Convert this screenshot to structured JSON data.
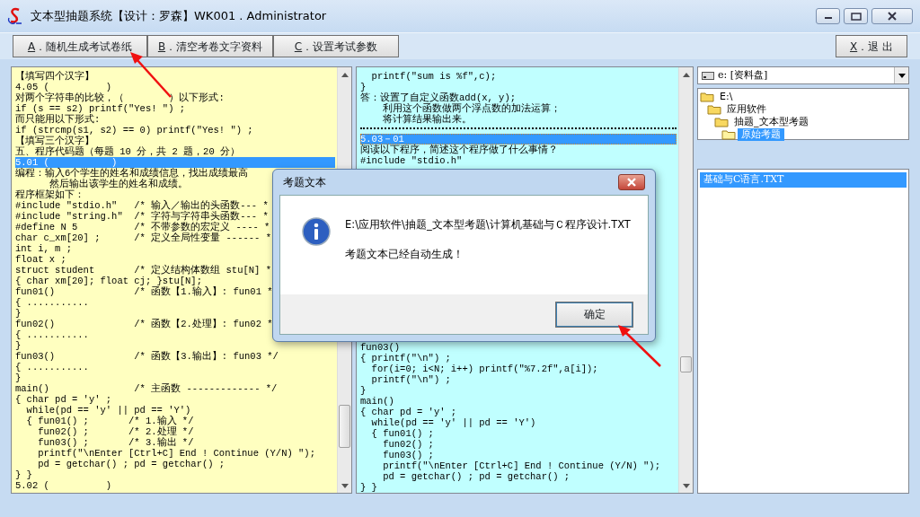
{
  "window": {
    "title": "文本型抽题系统【设计：罗森】WK001 . Administrator"
  },
  "toolbar": [
    {
      "key": "A",
      "label": "．随机生成考试卷纸"
    },
    {
      "key": "B",
      "label": "．清空考卷文字资料"
    },
    {
      "key": "C",
      "label": "．设置考试参数"
    }
  ],
  "exit_button": {
    "key": "X",
    "label": "．退 出"
  },
  "question_pane": {
    "lines": [
      {
        "text": "【填写四个汉字】",
        "selected": false
      },
      {
        "text": "4.05 (          )",
        "selected": false
      },
      {
        "text": "对两个字符串的比较，（        ）以下形式:",
        "selected": false
      },
      {
        "text": "if (s == s2) printf(\"Yes! \") ;",
        "selected": false
      },
      {
        "text": "而只能用以下形式:",
        "selected": false
      },
      {
        "text": "if (strcmp(s1, s2) == 0) printf(\"Yes! \") ;",
        "selected": false
      },
      {
        "text": "【填写三个汉字】",
        "selected": false
      },
      {
        "text": "五、程序代码题（每题 10 分，共 2 题，20 分）",
        "selected": false
      },
      {
        "text": "5.01 (           )",
        "selected": true
      },
      {
        "text": "编程：输入6个学生的姓名和成绩信息，找出成绩最高",
        "selected": false
      },
      {
        "text": "      然后输出该学生的姓名和成绩。",
        "selected": false
      },
      {
        "text": "程序框架如下：",
        "selected": false
      },
      {
        "text": "#include \"stdio.h\"   /* 输入／输出的头函数--- *",
        "selected": false
      },
      {
        "text": "#include \"string.h\"  /* 字符与字符串头函数--- *",
        "selected": false
      },
      {
        "text": "#define N 5          /* 不带参数的宏定义 ---- *",
        "selected": false
      },
      {
        "text": "char c_xm[20] ;      /* 定义全局性变量 ------ *",
        "selected": false
      },
      {
        "text": "int i, m ;",
        "selected": false
      },
      {
        "text": "float x ;",
        "selected": false
      },
      {
        "text": "struct student       /* 定义结构体数组 stu[N] *",
        "selected": false
      },
      {
        "text": "{ char xm[20]; float cj; }stu[N];",
        "selected": false
      },
      {
        "text": "fun01()              /* 函数【1.输入】: fun01 *",
        "selected": false
      },
      {
        "text": "{ ...........",
        "selected": false
      },
      {
        "text": "}",
        "selected": false
      },
      {
        "text": "fun02()              /* 函数【2.处理】: fun02 *",
        "selected": false
      },
      {
        "text": "{ ...........",
        "selected": false
      },
      {
        "text": "}",
        "selected": false
      },
      {
        "text": "fun03()              /* 函数【3.输出】: fun03 */",
        "selected": false
      },
      {
        "text": "{ ...........",
        "selected": false
      },
      {
        "text": "}",
        "selected": false
      },
      {
        "text": "main()               /* 主函数 ------------- */",
        "selected": false
      },
      {
        "text": "{ char pd = 'y' ;",
        "selected": false
      },
      {
        "text": "  while(pd == 'y' || pd == 'Y')",
        "selected": false
      },
      {
        "text": "  { fun01() ;       /* 1.输入 */",
        "selected": false
      },
      {
        "text": "    fun02() ;       /* 2.处理 */",
        "selected": false
      },
      {
        "text": "    fun03() ;       /* 3.输出 */",
        "selected": false
      },
      {
        "text": "    printf(\"\\nEnter [Ctrl+C] End ! Continue (Y/N) \");",
        "selected": false
      },
      {
        "text": "    pd = getchar() ; pd = getchar() ;",
        "selected": false
      },
      {
        "text": "} }",
        "selected": false
      },
      {
        "text": "5.02 (          )",
        "selected": false
      }
    ]
  },
  "answer_pane": {
    "lines_top": [
      {
        "text": "  printf(\"sum is %f\",c);",
        "selected": false
      },
      {
        "text": "}",
        "selected": false
      },
      {
        "text": "答：设置了自定义函数add(x, y);",
        "selected": false
      },
      {
        "text": "    利用这个函数做两个浮点数的加法运算；",
        "selected": false
      },
      {
        "text": "    将计算结果输出来。",
        "selected": false
      },
      {
        "kind": "separator"
      },
      {
        "text": "5.03－01",
        "selected": true
      },
      {
        "text": "阅读以下程序，简述这个程序做了什么事情？",
        "selected": false
      },
      {
        "text": "#include \"stdio.h\"",
        "selected": false
      }
    ],
    "lines_bottom": [
      {
        "text": "fun03()",
        "selected": false
      },
      {
        "text": "{ printf(\"\\n\") ;",
        "selected": false
      },
      {
        "text": "  for(i=0; i<N; i++) printf(\"%7.2f\",a[i]);",
        "selected": false
      },
      {
        "text": "  printf(\"\\n\") ;",
        "selected": false
      },
      {
        "text": "}",
        "selected": false
      },
      {
        "text": "main()",
        "selected": false
      },
      {
        "text": "{ char pd = 'y' ;",
        "selected": false
      },
      {
        "text": "  while(pd == 'y' || pd == 'Y')",
        "selected": false
      },
      {
        "text": "  { fun01() ;",
        "selected": false
      },
      {
        "text": "    fun02() ;",
        "selected": false
      },
      {
        "text": "    fun03() ;",
        "selected": false
      },
      {
        "text": "    printf(\"\\nEnter [Ctrl+C] End ! Continue (Y/N) \");",
        "selected": false
      },
      {
        "text": "    pd = getchar() ; pd = getchar() ;",
        "selected": false
      },
      {
        "text": "} }",
        "selected": false
      }
    ]
  },
  "drive_select": {
    "value": "e: [资料盘]"
  },
  "folder_tree": [
    {
      "label": "E:\\",
      "selected": false,
      "children": [
        {
          "label": "应用软件",
          "selected": false,
          "children": [
            {
              "label": "抽题_文本型考题",
              "selected": false,
              "children": [
                {
                  "label": "原始考题",
                  "selected": true
                }
              ]
            }
          ]
        }
      ]
    }
  ],
  "files": [
    {
      "name": "基础与C语言.TXT",
      "selected": true
    }
  ],
  "dialog": {
    "title": "考题文本",
    "path": "E:\\应用软件\\抽题_文本型考题\\计算机基础与Ｃ程序设计.TXT",
    "message": "考题文本已经自动生成！",
    "ok_button": "确定"
  }
}
